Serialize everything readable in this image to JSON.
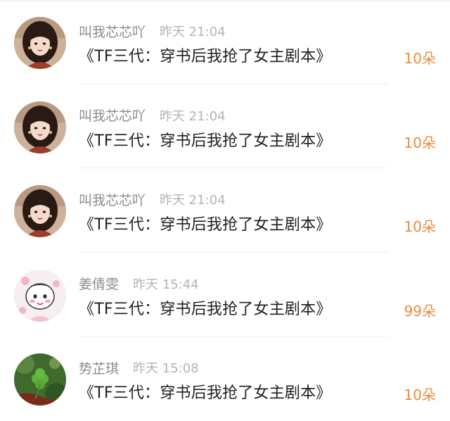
{
  "colors": {
    "username": "#8b8b8b",
    "time": "#b3b3b3",
    "title": "#1f1f1f",
    "count_accent": "#f08a3a"
  },
  "rows": [
    {
      "avatar": "girl-portrait-avatar",
      "username": "叫我芯芯吖",
      "time": "昨天 21:04",
      "title": "《TF三代：穿书后我抢了女主剧本》",
      "count": "10朵"
    },
    {
      "avatar": "girl-portrait-avatar",
      "username": "叫我芯芯吖",
      "time": "昨天 21:04",
      "title": "《TF三代：穿书后我抢了女主剧本》",
      "count": "10朵"
    },
    {
      "avatar": "girl-portrait-avatar",
      "username": "叫我芯芯吖",
      "time": "昨天 21:04",
      "title": "《TF三代：穿书后我抢了女主剧本》",
      "count": "10朵"
    },
    {
      "avatar": "cartoon-character-avatar",
      "username": "姜倩雯",
      "time": "昨天 15:44",
      "title": "《TF三代：穿书后我抢了女主剧本》",
      "count": "99朵"
    },
    {
      "avatar": "clover-photo-avatar",
      "username": "势芷琪",
      "time": "昨天 15:08",
      "title": "《TF三代：穿书后我抢了女主剧本》",
      "count": "10朵"
    }
  ]
}
